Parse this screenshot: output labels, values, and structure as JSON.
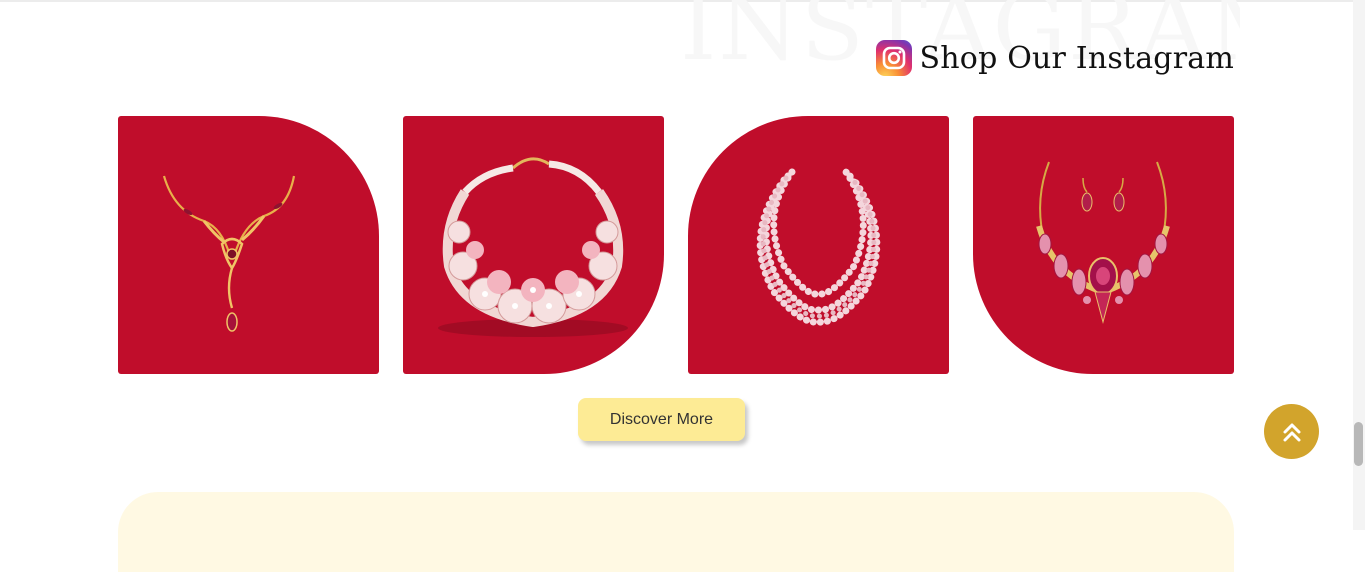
{
  "background_word": "INSTAGRAM",
  "section": {
    "title": "Shop Our Instagram",
    "icon": "instagram-icon"
  },
  "posts": [
    {
      "subject": "gold-pendant-necklace"
    },
    {
      "subject": "floral-pearl-necklace"
    },
    {
      "subject": "multi-strand-pearl-necklace"
    },
    {
      "subject": "ruby-necklace-earring-set"
    }
  ],
  "discover_button": {
    "label": "Discover More"
  },
  "scroll_to_top": {
    "icon": "double-chevron-up-icon"
  },
  "colors": {
    "card_red": "#c00d2b",
    "button_yellow": "#fdeb95",
    "scroll_button_gold": "#d2a42c",
    "footer_cream": "#fff9e3"
  }
}
